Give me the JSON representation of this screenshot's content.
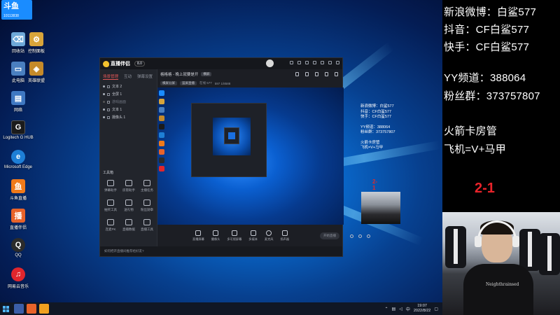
{
  "desktop": {
    "logo": {
      "title": "斗鱼",
      "number": "10113838"
    },
    "icons": [
      {
        "label": "回收站",
        "color": "#6ea8d8"
      },
      {
        "label": "控制面板",
        "color": "#d8a43a"
      },
      {
        "label": "此电脑",
        "color": "#4a7fc0"
      },
      {
        "label": "英雄联盟",
        "color": "#c58a2a"
      },
      {
        "label": "网络",
        "color": "#3f78c2"
      },
      {
        "label": "Logitech G HUB",
        "color": "#1b1b1b"
      },
      {
        "label": "Microsoft Edge",
        "color": "#1e7fd6"
      },
      {
        "label": "斗鱼直播",
        "color": "#f07a1a"
      },
      {
        "label": "直播伴侣",
        "color": "#e8632a"
      },
      {
        "label": "QQ",
        "color": "#2b2b2b"
      },
      {
        "label": "网易云音乐",
        "color": "#e0262d"
      }
    ]
  },
  "taskbar": {
    "time": "19:07",
    "date": "2022/8/22",
    "tray_lang": "中"
  },
  "app": {
    "name": "直播伴侣",
    "version": "8.0",
    "left_tabs": [
      "场景管理",
      "互动",
      "弹幕设置"
    ],
    "scenes": [
      {
        "label": "文本 2",
        "dim": false
      },
      {
        "label": "全屏 1",
        "dim": false
      },
      {
        "label": "游戏画面",
        "dim": true
      },
      {
        "label": "文本 1",
        "dim": false
      },
      {
        "label": "摄像头 1",
        "dim": false
      }
    ],
    "toolbox_title": "工具箱",
    "tools": [
      "弹幕助手",
      "房管助手",
      "主播任务",
      "抽奖工具",
      "送礼物",
      "粉丝勋章",
      "连麦PK",
      "直播数据",
      "直播工具",
      "更多"
    ],
    "footer_text": "如何把开直播间推荐给好友?",
    "main_title": "格格格 - 晚上就要是开",
    "main_pill": "横屏",
    "sub_chips": [
      "横屏分屏",
      "竖屏直播"
    ],
    "sub_stats": [
      "在线 577",
      "597 1/8588"
    ],
    "controls": [
      "直播屏幕",
      "摄像头",
      "多可视屏幕",
      "多媒体",
      "麦克风",
      "扬声器"
    ],
    "start_label": "开始直播",
    "preview_overlay": {
      "lines": [
        "新浪微博：白鲨577",
        "抖音：CF白鲨577",
        "快手：CF白鲨577",
        "",
        "YY频道：388064",
        "粉丝群：373757807",
        "",
        "火箭卡房管",
        "飞机=V+马甲"
      ],
      "score": "2-1"
    }
  },
  "overlay": {
    "lines": [
      "新浪微博：白鲨577",
      "抖音：CF白鲨577",
      "快手：CF白鲨577",
      "YY频道：388064",
      "粉丝群：373757807",
      "火箭卡房管",
      "飞机=V+马甲"
    ],
    "score": "2-1",
    "score_color": "#e8232a"
  },
  "webcam": {
    "shirt_text": "Neighthrainsed"
  }
}
